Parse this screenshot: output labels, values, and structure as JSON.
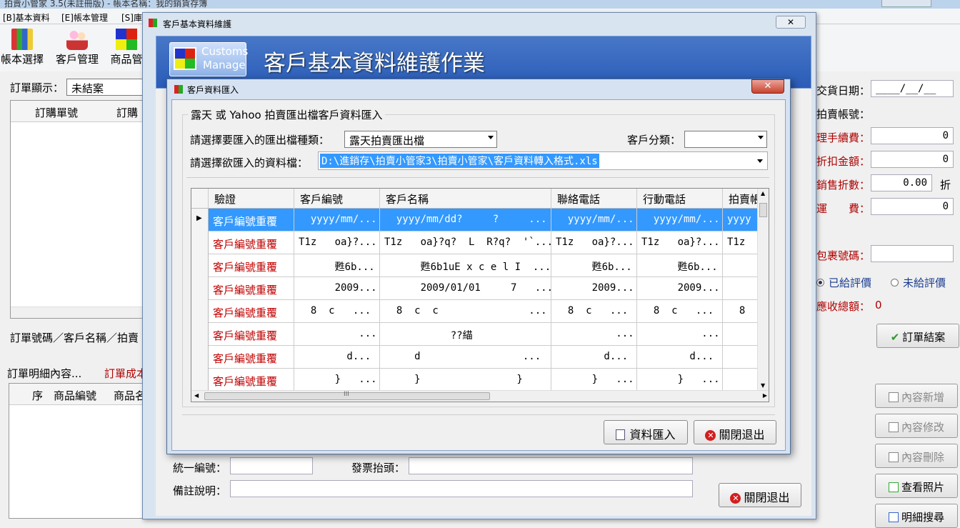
{
  "app": {
    "title": "拍賣小管家 3.5(未註冊版) - 帳本名稱：我的銷貨存簿"
  },
  "menu": [
    "[B]基本資料",
    "[E]帳本管理",
    "[S]庫存"
  ],
  "toolbar": {
    "items": [
      {
        "label": "帳本選擇",
        "icon": "books-icon"
      },
      {
        "label": "客戶管理",
        "icon": "users-icon"
      },
      {
        "label": "商品管",
        "icon": "grid-icon"
      }
    ]
  },
  "main": {
    "order_display_label": "訂單顯示：",
    "order_display_value": "未結案",
    "order_list_headers": [
      "訂購單號",
      "訂購"
    ],
    "search_label": "訂單號碼／客戶名稱／拍賣",
    "detail_label": "訂單明細內容...",
    "detail_cost_label": "訂單成本",
    "detail_headers": [
      "序",
      "商品編號",
      "商品名"
    ]
  },
  "right_panel": {
    "ship_date_label": "交貨日期：",
    "ship_date_value": "____/__/__",
    "auction_account_label": "拍賣帳號：",
    "fee_label": "理手續費：",
    "fee_value": "0",
    "discount_label": "折扣金額：",
    "discount_value": "0",
    "sales_discount_label": "銷售折數：",
    "sales_discount_value": "0.00",
    "sales_discount_unit": "折",
    "shipping_label": "運　　費：",
    "shipping_value": "0",
    "package_label": "包裹號碼：",
    "rated_label": "已給評價",
    "unrated_label": "未給評價",
    "receivable_label": "應收總額：",
    "receivable_value": "0",
    "close_order_button": "訂單結案",
    "buttons": [
      "內容新增",
      "內容修改",
      "內容刪除",
      "查看照片",
      "明細搜尋"
    ]
  },
  "customer_window": {
    "title": "客戶基本資料維護",
    "close": "✕",
    "logo_line1": "Customs",
    "logo_line2": "Manage",
    "banner_title": "客戶基本資料維護作業",
    "tax_id_label": "統一編號：",
    "invoice_title_label": "發票抬頭：",
    "note_label": "備註說明：",
    "close_button": "關閉退出"
  },
  "import_dialog": {
    "title": "客戶資料匯入",
    "close": "✕",
    "group_title": "露天 或 Yahoo 拍賣匯出檔客戶資料匯入",
    "file_type_label": "請選擇要匯入的匯出檔種類：",
    "file_type_value": "露天拍賣匯出檔",
    "category_label": "客戶分類：",
    "category_value": "",
    "file_label": "請選擇欲匯入的資料檔：",
    "file_value": "D:\\進銷存\\拍賣小管家3\\拍賣小管家\\客戶資料轉入格式.xls",
    "columns": [
      "驗證",
      "客戶編號",
      "客戶名稱",
      "聯絡電話",
      "行動電話",
      "拍賣帳"
    ],
    "rows": [
      [
        "客戶編號重覆",
        "  yyyy/mm/...",
        "  yyyy/mm/dd?     ?     ...",
        "  yyyy/mm/...",
        "  yyyy/mm/...",
        "yyyy"
      ],
      [
        "客戶編號重覆",
        "T1z   oa}?...",
        "T1z   oa}?q?  L  R?q?  '`...",
        "T1z   oa}?...",
        "T1z   oa}?...",
        "T1z"
      ],
      [
        "客戶編號重覆",
        "      甦6b...",
        "      甦6b1uE x c e l I  ...",
        "      甦6b...",
        "      甦6b...",
        ""
      ],
      [
        "客戶編號重覆",
        "      2009...",
        "      2009/01/01     7   ...",
        "      2009...",
        "      2009...",
        ""
      ],
      [
        "客戶編號重覆",
        "  8  c   ...",
        "  8  c  c               ...",
        "  8  c   ...",
        "  8  c   ...",
        "  8"
      ],
      [
        "客戶編號重覆",
        "          ...",
        "           ??緢           ",
        "          ...",
        "          ...",
        ""
      ],
      [
        "客戶編號重覆",
        "        d...",
        "     d                 ...",
        "        d...",
        "        d...",
        ""
      ],
      [
        "客戶編號重覆",
        "      }   ...",
        "     }                }   ",
        "      }   ...",
        "      }   ...",
        ""
      ]
    ],
    "hscroll_mark": "III",
    "import_button": "資料匯入",
    "close_button": "關閉退出"
  }
}
